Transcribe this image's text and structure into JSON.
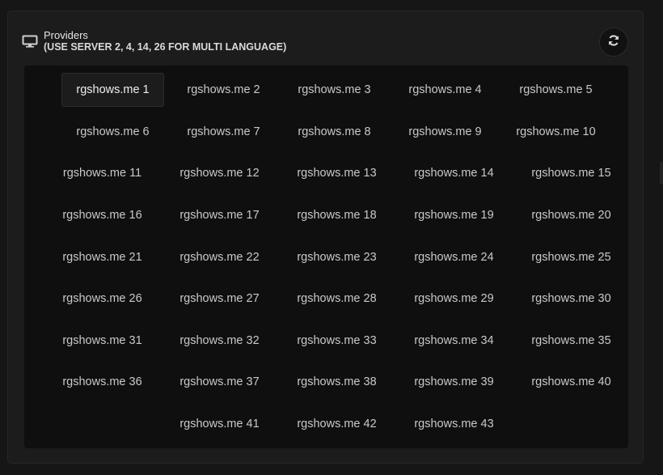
{
  "header": {
    "title": "Providers",
    "subtitle": "(USE SERVER 2, 4, 14, 26 FOR MULTI LANGUAGE)",
    "icon": "monitor-icon",
    "refresh_icon": "refresh-icon"
  },
  "servers": {
    "selected_index": 0,
    "items": [
      {
        "label": "rgshows.me 1"
      },
      {
        "label": "rgshows.me 2"
      },
      {
        "label": "rgshows.me 3"
      },
      {
        "label": "rgshows.me 4"
      },
      {
        "label": "rgshows.me 5"
      },
      {
        "label": "rgshows.me 6"
      },
      {
        "label": "rgshows.me 7"
      },
      {
        "label": "rgshows.me 8"
      },
      {
        "label": "rgshows.me 9"
      },
      {
        "label": "rgshows.me 10"
      },
      {
        "label": "rgshows.me 11"
      },
      {
        "label": "rgshows.me 12"
      },
      {
        "label": "rgshows.me 13"
      },
      {
        "label": "rgshows.me 14"
      },
      {
        "label": "rgshows.me 15"
      },
      {
        "label": "rgshows.me 16"
      },
      {
        "label": "rgshows.me 17"
      },
      {
        "label": "rgshows.me 18"
      },
      {
        "label": "rgshows.me 19"
      },
      {
        "label": "rgshows.me 20"
      },
      {
        "label": "rgshows.me 21"
      },
      {
        "label": "rgshows.me 22"
      },
      {
        "label": "rgshows.me 23"
      },
      {
        "label": "rgshows.me 24"
      },
      {
        "label": "rgshows.me 25"
      },
      {
        "label": "rgshows.me 26"
      },
      {
        "label": "rgshows.me 27"
      },
      {
        "label": "rgshows.me 28"
      },
      {
        "label": "rgshows.me 29"
      },
      {
        "label": "rgshows.me 30"
      },
      {
        "label": "rgshows.me 31"
      },
      {
        "label": "rgshows.me 32"
      },
      {
        "label": "rgshows.me 33"
      },
      {
        "label": "rgshows.me 34"
      },
      {
        "label": "rgshows.me 35"
      },
      {
        "label": "rgshows.me 36"
      },
      {
        "label": "rgshows.me 37"
      },
      {
        "label": "rgshows.me 38"
      },
      {
        "label": "rgshows.me 39"
      },
      {
        "label": "rgshows.me 40"
      },
      {
        "label": "rgshows.me 41"
      },
      {
        "label": "rgshows.me 42"
      },
      {
        "label": "rgshows.me 43"
      }
    ]
  },
  "colors": {
    "background": "#161616",
    "panel": "#1c1c1c",
    "grid": "#0f0f0f",
    "text": "#c9c9c9"
  }
}
